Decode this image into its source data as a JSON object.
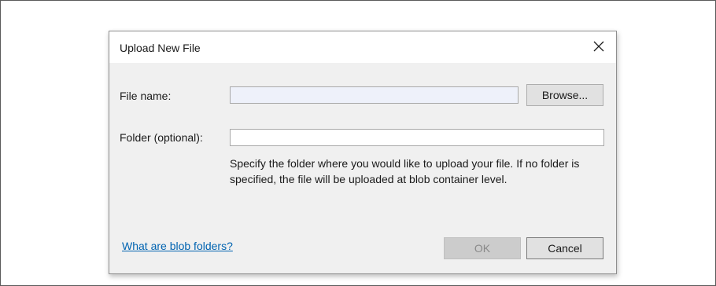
{
  "dialog": {
    "title": "Upload New File",
    "close_icon": "close-icon"
  },
  "form": {
    "file_name_label": "File name:",
    "file_name_value": "",
    "browse_label": "Browse...",
    "folder_label": "Folder (optional):",
    "folder_value": "",
    "folder_hint": "Specify the folder where you would like to upload your file. If no folder is specified, the file will be uploaded at blob container level."
  },
  "footer": {
    "help_link": "What are blob folders?",
    "ok_label": "OK",
    "ok_disabled": true,
    "cancel_label": "Cancel"
  },
  "colors": {
    "dialog_background": "#f0f0f0",
    "title_background": "#ffffff",
    "link": "#0063b1",
    "file_field_background": "#eef1fa",
    "disabled_button": "#cccccc"
  }
}
